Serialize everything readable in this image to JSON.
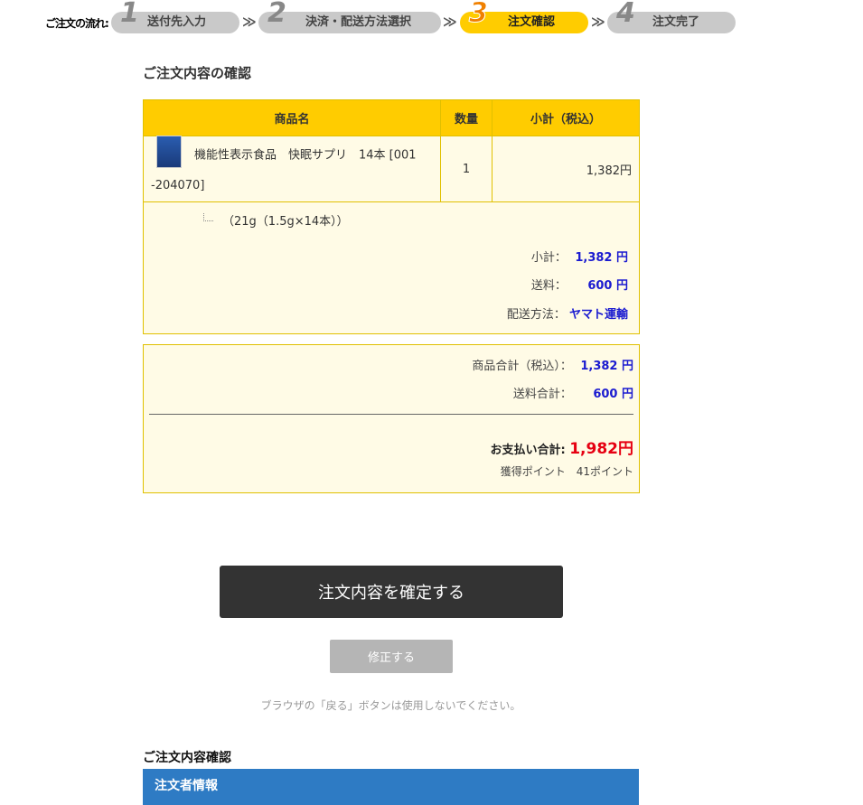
{
  "steps": {
    "label": "ご注文の流れ:",
    "items": [
      {
        "num": "1",
        "label": "送付先入力"
      },
      {
        "num": "2",
        "label": "決済・配送方法選択"
      },
      {
        "num": "3",
        "label": "注文確認"
      },
      {
        "num": "4",
        "label": "注文完了"
      }
    ],
    "arrow": "≫",
    "active_color": "#ffcc00"
  },
  "section_title": "ご注文内容の確認",
  "table": {
    "headers": [
      "商品名",
      "数量",
      "小計（税込）"
    ],
    "item": {
      "name_line1": "機能性表示食品　快眠サプリ　14本 [001",
      "name_line2": "-204070]",
      "qty": "1",
      "price": "1,382円"
    },
    "variant": "（21g（1.5g×14本））"
  },
  "summary": {
    "subtotal_label": "小計：",
    "subtotal_value": "1,382 円",
    "shipping_label": "送料：",
    "shipping_value": "600 円",
    "method_label": "配送方法：",
    "method_value": "ヤマト運輸"
  },
  "totals": {
    "items_label": "商品合計（税込）：",
    "items_value": "1,382 円",
    "shipping_label": "送料合計：",
    "shipping_value": "600 円",
    "pay_label": "お支払い合計:",
    "pay_value": "1,982円",
    "points": "獲得ポイント　41ポイント"
  },
  "buttons": {
    "confirm": "注文内容を確定する",
    "edit": "修正する"
  },
  "notice": "ブラウザの「戻る」ボタンは使用しないでください。",
  "confirm_section_title": "ご注文内容確認",
  "orderer_bar": "注文者情報",
  "colors": {
    "accent": "#ffcc00",
    "price": "#1a1ad0",
    "total": "#e60012",
    "bar": "#2e7bc4"
  }
}
